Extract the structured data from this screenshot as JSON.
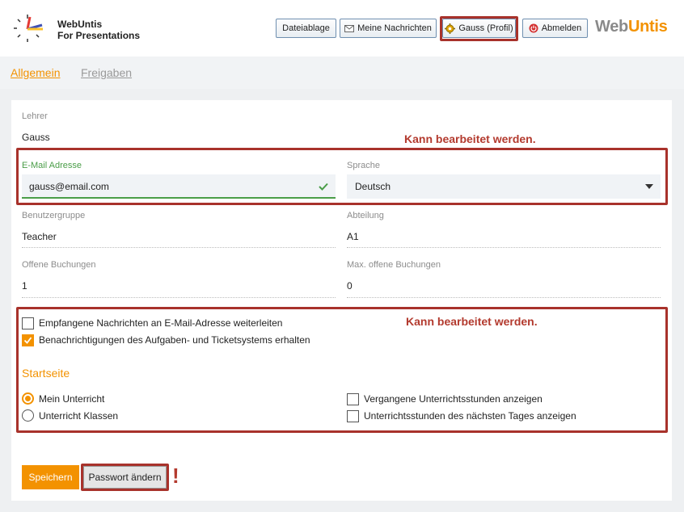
{
  "header": {
    "app_name_line1": "WebUntis",
    "app_name_line2": "For Presentations",
    "buttons": {
      "files": "Dateiablage",
      "messages": "Meine Nachrichten",
      "profile": "Gauss (Profil)",
      "logout": "Abmelden"
    },
    "brand_part1": "Web",
    "brand_part2": "Untis"
  },
  "tabs": {
    "general": "Allgemein",
    "shares": "Freigaben"
  },
  "form": {
    "teacher_label": "Lehrer",
    "teacher_value": "Gauss",
    "email_label": "E-Mail Adresse",
    "email_value": "gauss@email.com",
    "language_label": "Sprache",
    "language_value": "Deutsch",
    "usergroup_label": "Benutzergruppe",
    "usergroup_value": "Teacher",
    "department_label": "Abteilung",
    "department_value": "A1",
    "open_bookings_label": "Offene Buchungen",
    "open_bookings_value": "1",
    "max_open_bookings_label": "Max. offene Buchungen",
    "max_open_bookings_value": "0"
  },
  "notes": {
    "editable_1": "Kann bearbeitet werden.",
    "editable_2": "Kann bearbeitet werden."
  },
  "options": {
    "forward_messages": "Empfangene Nachrichten an E-Mail-Adresse weiterleiten",
    "forward_messages_checked": false,
    "ticket_notifications": "Benachrichtigungen des Aufgaben- und Ticketsystems erhalten",
    "ticket_notifications_checked": true
  },
  "startpage": {
    "title": "Startseite",
    "my_lessons": "Mein Unterricht",
    "class_lessons": "Unterricht Klassen",
    "selected": "Mein Unterricht",
    "show_past": "Vergangene Unterrichtsstunden anzeigen",
    "show_next_day": "Unterrichtsstunden des nächsten Tages anzeigen"
  },
  "actions": {
    "save": "Speichern",
    "change_password": "Passwort ändern",
    "exclamation": "!"
  },
  "colors": {
    "accent": "#f39200",
    "highlight": "#a8322b",
    "valid": "#4a9d48"
  }
}
